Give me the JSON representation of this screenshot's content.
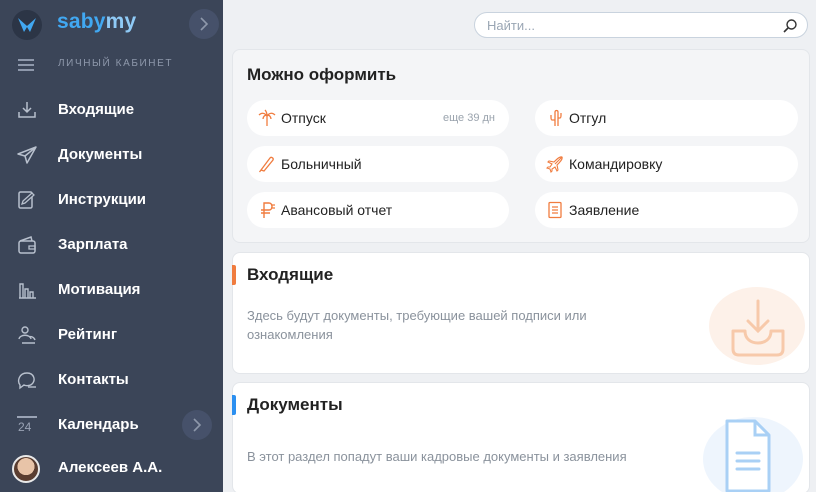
{
  "app": {
    "logo_part1": "saby",
    "logo_part2": "my",
    "cabinet_label": "ЛИЧНЫЙ КАБИНЕТ"
  },
  "sidebar": {
    "items": [
      {
        "label": "Входящие",
        "icon": "inbox-download-icon"
      },
      {
        "label": "Документы",
        "icon": "paper-plane-icon"
      },
      {
        "label": "Инструкции",
        "icon": "edit-document-icon"
      },
      {
        "label": "Зарплата",
        "icon": "wallet-icon"
      },
      {
        "label": "Мотивация",
        "icon": "bar-chart-icon"
      },
      {
        "label": "Рейтинг",
        "icon": "people-icon"
      },
      {
        "label": "Контакты",
        "icon": "chat-bubble-icon"
      },
      {
        "label": "Календарь",
        "icon": "calendar-icon",
        "day": "24"
      }
    ],
    "user": {
      "name": "Алексеев А.А."
    }
  },
  "search": {
    "placeholder": "Найти..."
  },
  "quick_actions": {
    "title": "Можно оформить",
    "items": [
      {
        "label": "Отпуск",
        "extra": "еще 39 дн",
        "icon": "palm-tree-icon"
      },
      {
        "label": "Отгул",
        "icon": "cactus-icon"
      },
      {
        "label": "Больничный",
        "icon": "thermometer-icon"
      },
      {
        "label": "Командировку",
        "icon": "airplane-icon"
      },
      {
        "label": "Авансовый отчет",
        "icon": "ruble-icon"
      },
      {
        "label": "Заявление",
        "icon": "document-icon"
      }
    ]
  },
  "incoming": {
    "title": "Входящие",
    "description": "Здесь будут документы, требующие вашей подписи или ознакомления"
  },
  "documents": {
    "title": "Документы",
    "description": "В этот раздел попадут ваши кадровые документы и заявления"
  },
  "colors": {
    "sidebar_bg": "#3b4558",
    "brand_blue": "#41a8f2",
    "accent_orange": "#f07c3f",
    "accent_blue": "#2b8ff0"
  }
}
